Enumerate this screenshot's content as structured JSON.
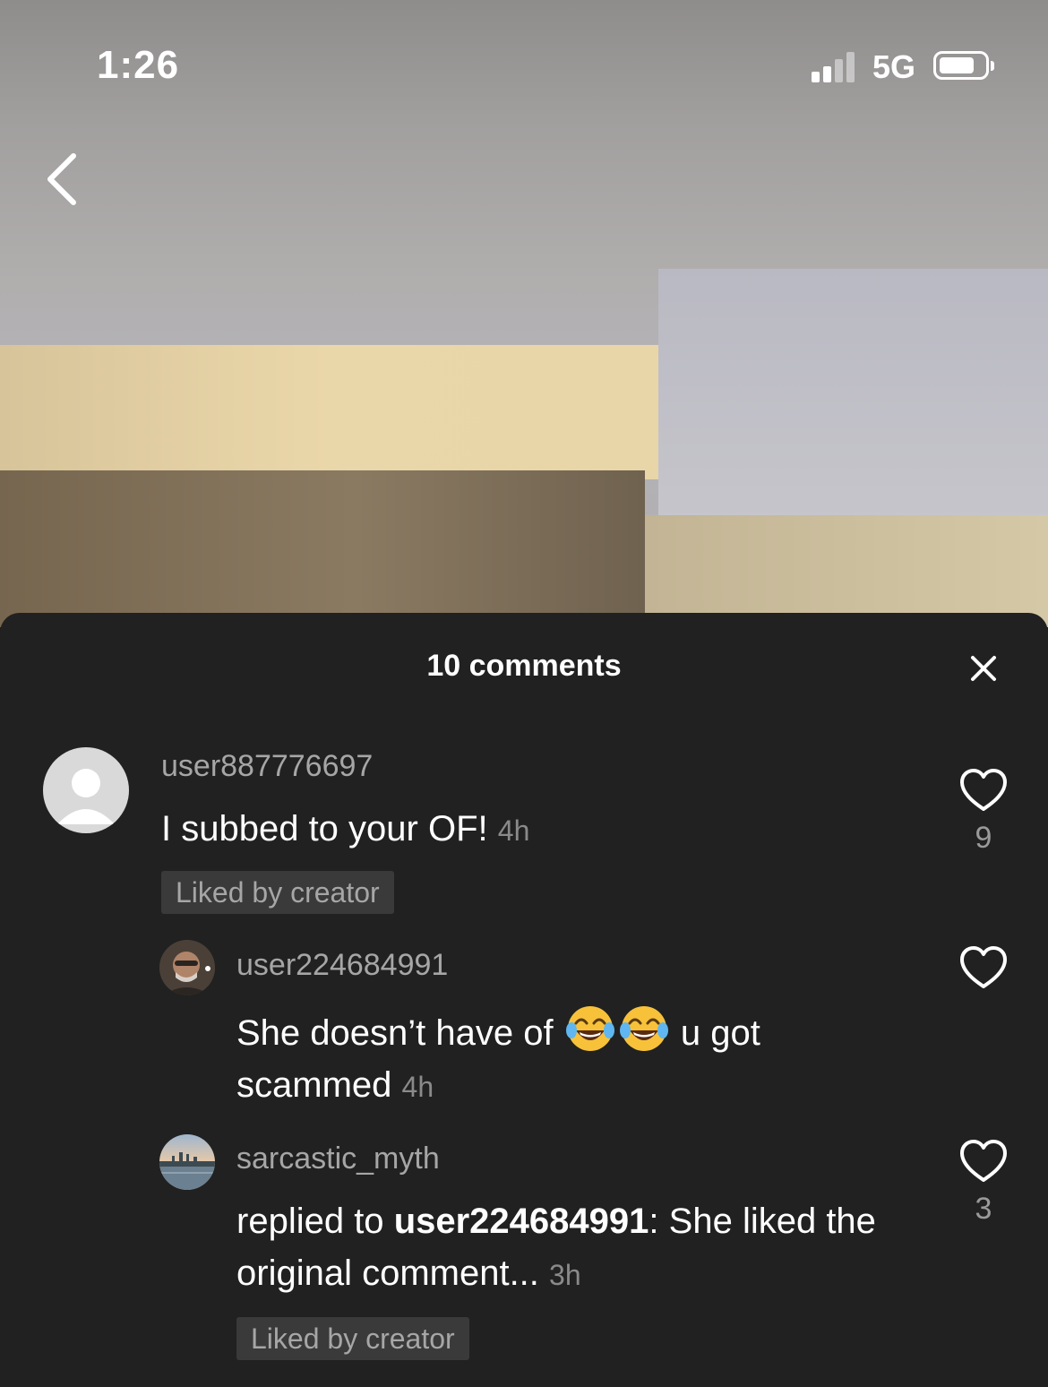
{
  "status_bar": {
    "time": "1:26",
    "network": "5G",
    "signal_icon": "signal-bars-icon",
    "battery_icon": "battery-icon"
  },
  "navigation": {
    "back_icon": "chevron-left-icon"
  },
  "comments_sheet": {
    "title": "10 comments",
    "close_icon": "close-icon",
    "comments": [
      {
        "username": "user887776697",
        "text": "I subbed to your OF!",
        "time": "4h",
        "badge": "Liked by creator",
        "like_count": "9",
        "avatar": "default-avatar-icon"
      },
      {
        "username": "user224684991",
        "text_before_emoji": "She doesn’t have of",
        "emojis": [
          "tears-of-joy-emoji",
          "tears-of-joy-emoji"
        ],
        "text_after_emoji": "u got scammed",
        "time": "4h",
        "like_count": "",
        "avatar": "user-photo-avatar"
      },
      {
        "username": "sarcastic_myth",
        "reply_prefix": "replied to",
        "reply_to": "user224684991",
        "reply_sep": ":",
        "text": "She liked the original comment...",
        "time": "3h",
        "badge": "Liked by creator",
        "like_count": "3",
        "avatar": "city-skyline-avatar"
      }
    ]
  },
  "colors": {
    "sheet_background": "#212121",
    "badge_background": "#3a3a3a",
    "secondary_text": "#a6a6a6"
  }
}
